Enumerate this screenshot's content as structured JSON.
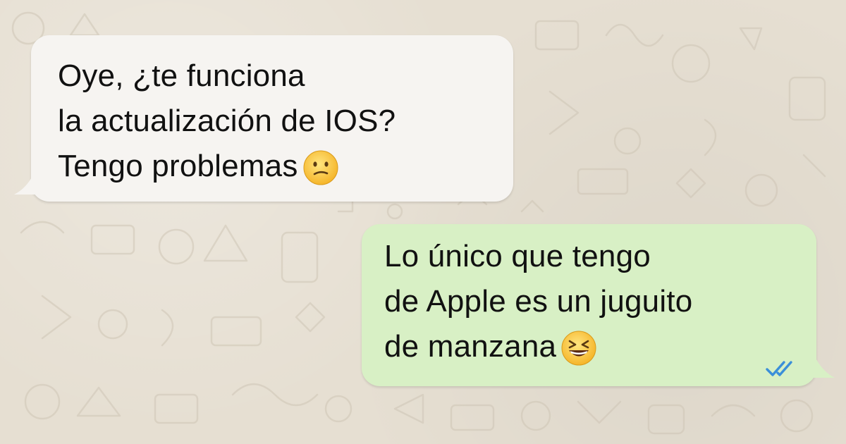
{
  "chat": {
    "incoming_message": {
      "lines": [
        "Oye, ¿te funciona",
        "la actualización de IOS?",
        "Tengo problemas"
      ],
      "emoji": "confused-face-emoji"
    },
    "outgoing_message": {
      "lines": [
        "Lo único que tengo",
        "de Apple es un juguito",
        "de manzana"
      ],
      "emoji": "laughing-face-emoji",
      "status": "read-double-check-icon"
    }
  },
  "colors": {
    "background": "#e6dfd2",
    "incoming_bubble": "#f6f4f1",
    "outgoing_bubble": "#d8f0c5",
    "read_ticks": "#3b8fd9",
    "text": "#111111"
  }
}
